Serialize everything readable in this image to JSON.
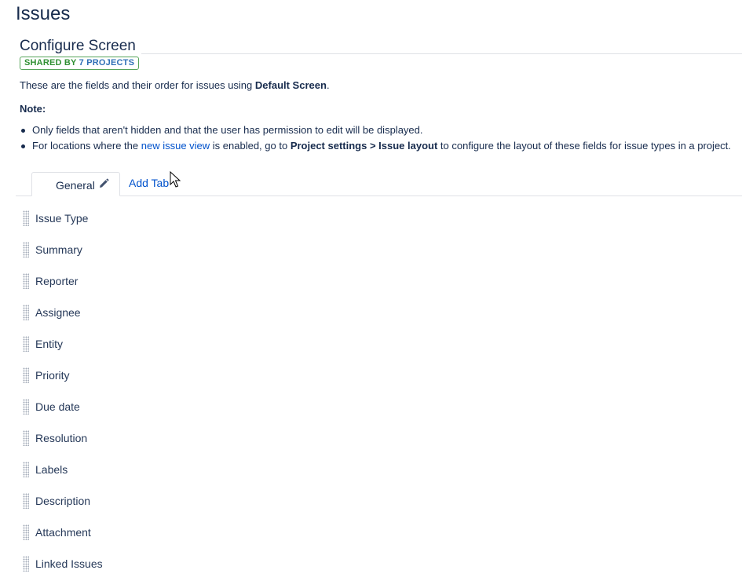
{
  "page": {
    "title": "Issues"
  },
  "screen": {
    "title": "Configure Screen",
    "badge": {
      "part1": "SHARED BY ",
      "part2": "7 PROJECTS"
    },
    "description": {
      "prefix": "These are the fields and their order for issues using ",
      "screen_name": "Default Screen",
      "suffix": "."
    },
    "note_label": "Note:",
    "notes": {
      "item1": "Only fields that aren't hidden and that the user has permission to edit will be displayed.",
      "item2": {
        "prefix": "For locations where the ",
        "link": "new issue view",
        "middle": " is enabled, go to ",
        "path": "Project settings > Issue layout",
        "suffix": " to configure the layout of these fields for issue types in a project."
      }
    }
  },
  "tabs": {
    "general_label": "General",
    "add_label": "Add Tab"
  },
  "fields": [
    "Issue Type",
    "Summary",
    "Reporter",
    "Assignee",
    "Entity",
    "Priority",
    "Due date",
    "Resolution",
    "Labels",
    "Description",
    "Attachment",
    "Linked Issues"
  ],
  "icons": {
    "edit": "pencil-icon",
    "drag": "drag-handle-icon",
    "pointer": "mouse-cursor-icon"
  }
}
